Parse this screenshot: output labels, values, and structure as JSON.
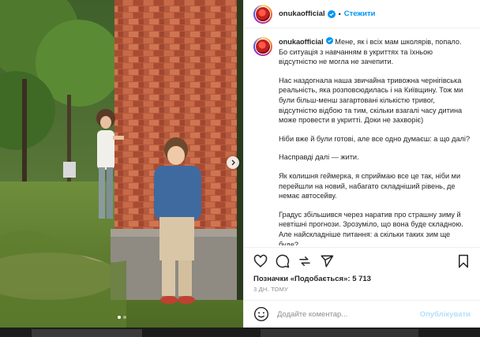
{
  "post": {
    "username": "onukaofficial",
    "follow_label": "Стежити",
    "separator": "•",
    "caption_paragraphs": [
      "Мене, як і всіх мам школярів, попало. Бо ситуація з навчанням в укриттях та їхньою відсутністю не могла не зачепити.",
      "Нас наздогнала наша звичайна тривожна чернігівська реальність, яка розповсюдилась і на Київщину. Тож ми були більш-менш загартовані кількістю тривог, відсутністю відбою та тим, скільки взагалі часу дитина може провести в укритті. Доки не захворіє)",
      "Ніби вже й були готові, але все одно думаєш: а що далі?",
      "Насправді далі — жити.",
      "Як колишня геймерка, я сприймаю все це так, ніби ми перейшли на новий, набагато складніший рівень, де немає автосейву.",
      "Градус збільшився через наратив про страшну зиму й невтішні прогнози. Зрозуміло, що вона буде складною. Але найскладніше питання: а скільки таких зим ще буде?"
    ],
    "likes_text": "Позначки «Подобається»: 5 713",
    "time_text": "3 ДН. ТОМУ",
    "comment_placeholder": "Додайте коментар...",
    "publish_label": "Опублікувати",
    "carousel": {
      "slide_count": 2,
      "active_index": 0
    }
  },
  "icons": {
    "verified": "verified-badge-icon",
    "like": "heart-icon",
    "comment": "comment-icon",
    "share": "share-icon",
    "send": "send-icon",
    "save": "bookmark-icon",
    "emoji": "emoji-icon",
    "next": "chevron-right-icon"
  },
  "colors": {
    "link_blue": "#0095f6",
    "publish_disabled": "#b2dffc",
    "muted_text": "#8e8e8e",
    "brick": "#b5553a"
  }
}
